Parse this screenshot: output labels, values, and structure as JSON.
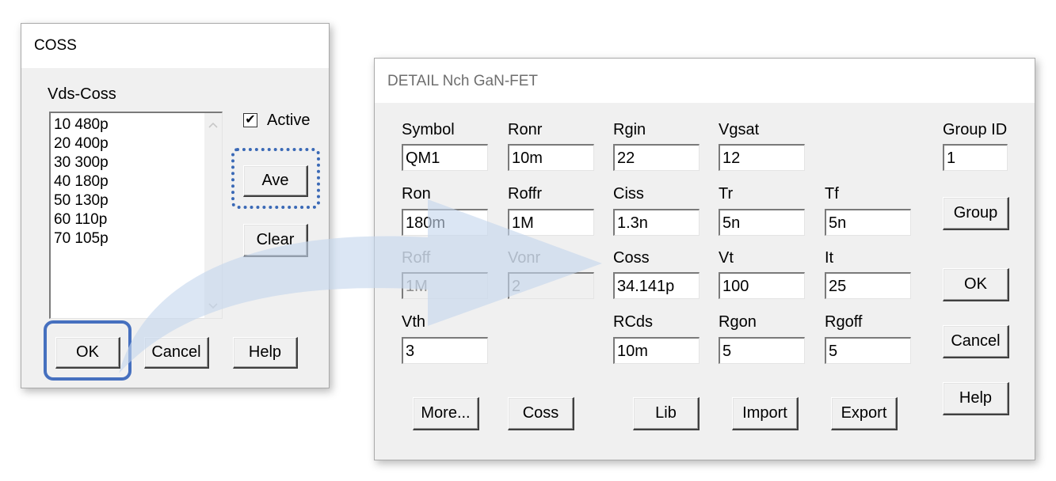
{
  "coss_dialog": {
    "title": "COSS",
    "list_label": "Vds-Coss",
    "list_items": [
      "10 480p",
      "20 400p",
      "30 300p",
      "40 180p",
      "50 130p",
      "60 110p",
      "70 105p"
    ],
    "active_label": "Active",
    "active_checked": true,
    "active_mark": "✔",
    "ave_label": "Ave",
    "clear_label": "Clear",
    "ok_label": "OK",
    "cancel_label": "Cancel",
    "help_label": "Help"
  },
  "detail_dialog": {
    "title": "DETAIL Nch GaN-FET",
    "fields": {
      "symbol": {
        "label": "Symbol",
        "value": "QM1"
      },
      "ronr": {
        "label": "Ronr",
        "value": "10m"
      },
      "rgin": {
        "label": "Rgin",
        "value": "22"
      },
      "vgsat": {
        "label": "Vgsat",
        "value": "12"
      },
      "group_id": {
        "label": "Group ID",
        "value": "1"
      },
      "ron": {
        "label": "Ron",
        "value": "180m"
      },
      "roffr": {
        "label": "Roffr",
        "value": "1M"
      },
      "ciss": {
        "label": "Ciss",
        "value": "1.3n"
      },
      "tr": {
        "label": "Tr",
        "value": "5n"
      },
      "tf": {
        "label": "Tf",
        "value": "5n"
      },
      "roff": {
        "label": "Roff",
        "value": "1M"
      },
      "vonr": {
        "label": "Vonr",
        "value": "2"
      },
      "coss": {
        "label": "Coss",
        "value": "34.141p"
      },
      "vt": {
        "label": "Vt",
        "value": "100"
      },
      "it": {
        "label": "It",
        "value": "25"
      },
      "vth": {
        "label": "Vth",
        "value": "3"
      },
      "rcds": {
        "label": "RCds",
        "value": "10m"
      },
      "rgon": {
        "label": "Rgon",
        "value": "5"
      },
      "rgoff": {
        "label": "Rgoff",
        "value": "5"
      }
    },
    "buttons": {
      "group": "Group",
      "ok": "OK",
      "cancel": "Cancel",
      "help": "Help",
      "more": "More...",
      "coss": "Coss",
      "lib": "Lib",
      "import": "Import",
      "export": "Export"
    }
  },
  "colors": {
    "highlight": "#4670bf",
    "arrow": "#c5d7ee"
  }
}
